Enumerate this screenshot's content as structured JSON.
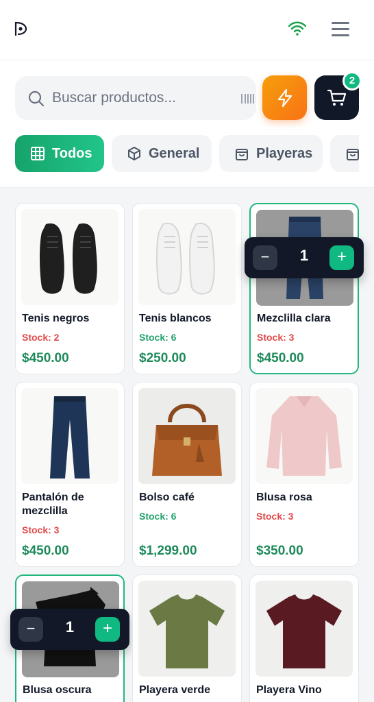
{
  "header": {
    "brand_logo": "p-logo-icon",
    "wifi_icon": "wifi-icon",
    "menu_icon": "hamburger-menu-icon"
  },
  "search": {
    "placeholder": "Buscar productos..."
  },
  "cart": {
    "count": "2"
  },
  "categories": [
    {
      "label": "Todos",
      "icon": "grid-icon",
      "active": true
    },
    {
      "label": "General",
      "icon": "box-icon",
      "active": false
    },
    {
      "label": "Playeras",
      "icon": "bag-icon",
      "active": false
    },
    {
      "label": "",
      "icon": "bag-icon",
      "active": false
    }
  ],
  "products": [
    {
      "name": "Tenis negros",
      "stock": "Stock: 2",
      "stock_status": "low",
      "price": "$450.00",
      "selected": false
    },
    {
      "name": "Tenis blancos",
      "stock": "Stock: 6",
      "stock_status": "ok",
      "price": "$250.00",
      "selected": false
    },
    {
      "name": "Mezclilla clara",
      "stock": "Stock: 3",
      "stock_status": "low",
      "price": "$450.00",
      "selected": true,
      "quantity": "1"
    },
    {
      "name": "Pantalón de mezclilla",
      "stock": "Stock: 3",
      "stock_status": "low",
      "price": "$450.00",
      "selected": false
    },
    {
      "name": "Bolso café",
      "stock": "Stock: 6",
      "stock_status": "ok",
      "price": "$1,299.00",
      "selected": false
    },
    {
      "name": "Blusa rosa",
      "stock": "Stock: 3",
      "stock_status": "low",
      "price": "$350.00",
      "selected": false
    },
    {
      "name": "Blusa oscura",
      "stock": "",
      "price": "",
      "selected": true,
      "quantity": "1"
    },
    {
      "name": "Playera verde",
      "stock": "",
      "price": "",
      "selected": false
    },
    {
      "name": "Playera Vino",
      "stock": "",
      "price": "",
      "selected": false
    }
  ],
  "qty_controls": {
    "minus": "−",
    "plus": "+"
  },
  "colors": {
    "accent_green": "#10b981",
    "price_green": "#1e8a5a",
    "stock_low": "#e04848",
    "stock_ok": "#22a06b",
    "orange": "#f97316",
    "dark": "#111827"
  }
}
